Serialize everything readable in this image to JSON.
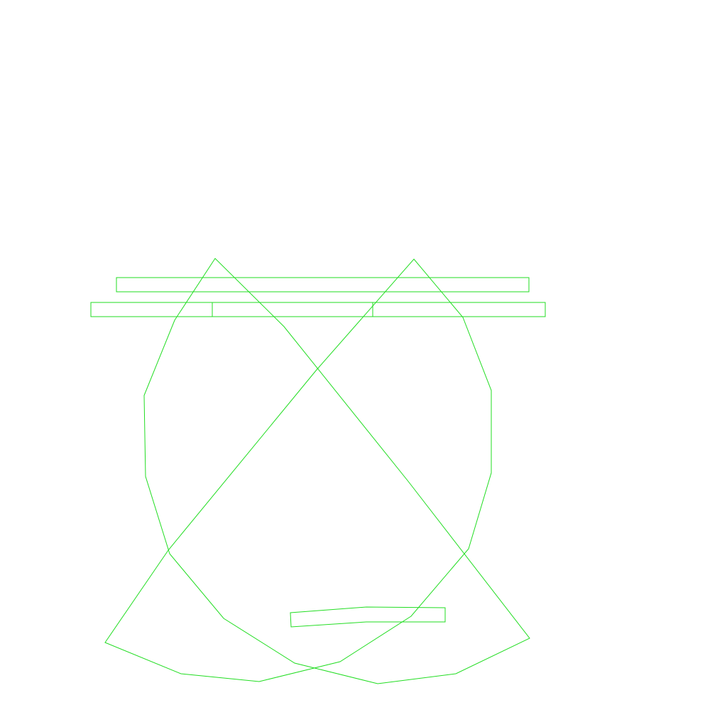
{
  "colors": {
    "background": "#ffffff",
    "stroke": "#22dd22"
  }
}
